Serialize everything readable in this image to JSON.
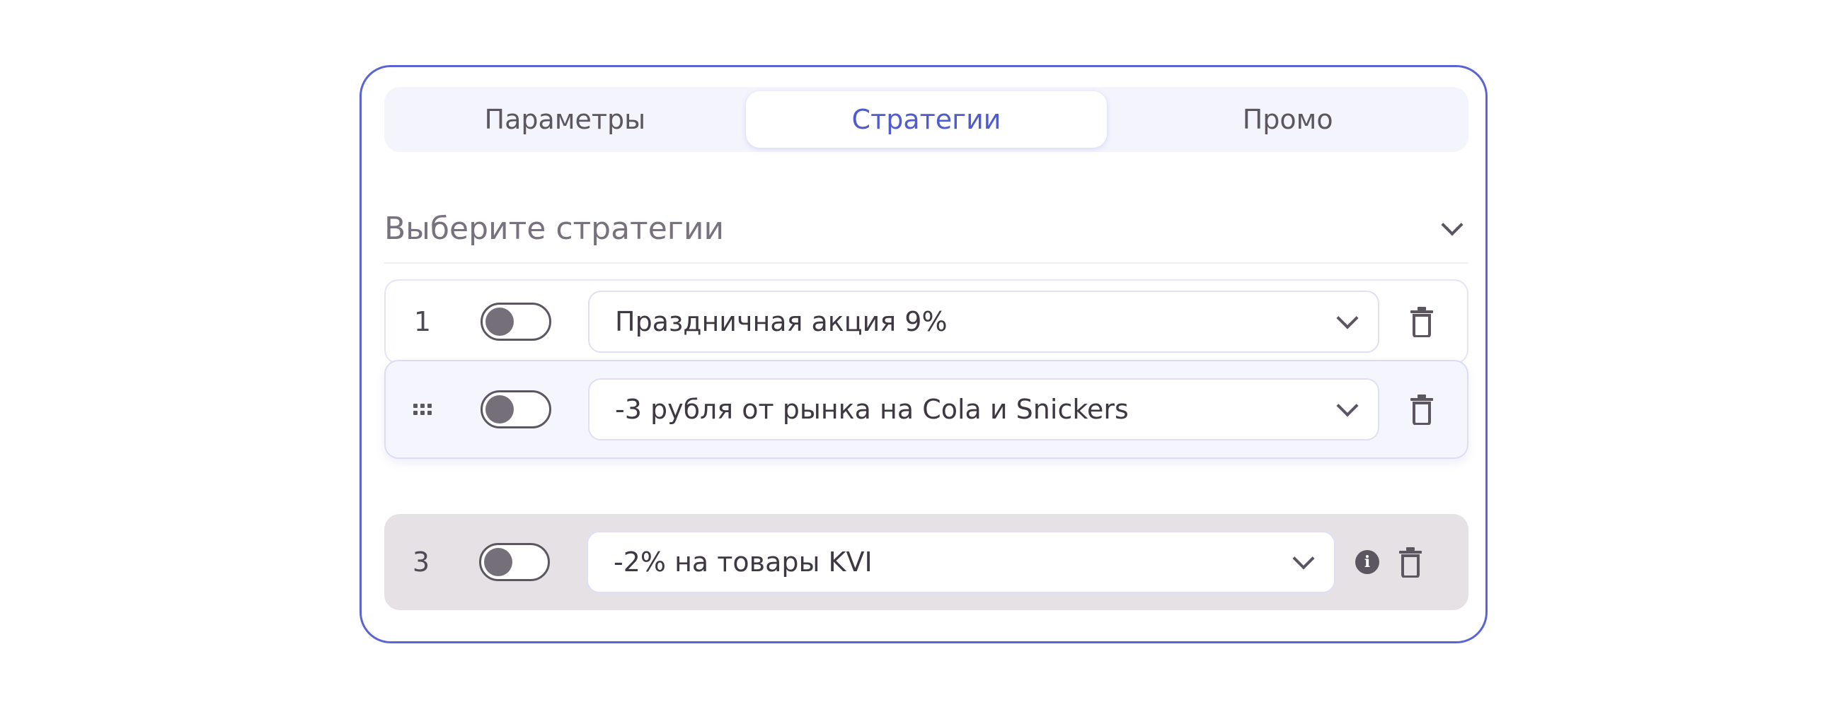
{
  "tabs": [
    {
      "label": "Параметры"
    },
    {
      "label": "Стратегии"
    },
    {
      "label": "Промо"
    }
  ],
  "active_tab": "Стратегии",
  "selector": {
    "label": "Выберите стратегии",
    "icon": "chevron-down-icon"
  },
  "strategies": [
    {
      "index": "1",
      "name": "Праздничная акция 9%",
      "enabled": false,
      "icon": "trash-icon"
    },
    {
      "index": "",
      "name": "-3 рубля от рынка на Cola и Snickers",
      "enabled": false,
      "dragging": true,
      "handle_icon": "drag-handle-icon",
      "icon": "trash-icon"
    },
    {
      "index": "3",
      "name": "-2% на товары KVI",
      "enabled": false,
      "disabled": true,
      "extra_icon": "info-icon",
      "icon": "trash-icon"
    }
  ],
  "colors": {
    "accent": "#4f5bd0",
    "panel_border": "#5a64d4",
    "tabs_bg": "#f4f4fd",
    "disabled_row_bg": "#e5e1e4",
    "text": "#3d3842"
  }
}
